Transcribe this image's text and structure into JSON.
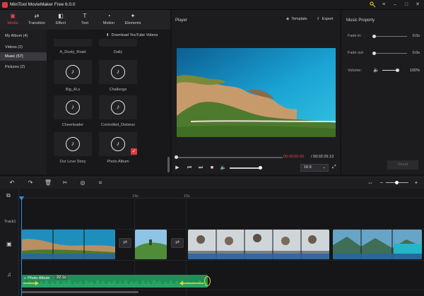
{
  "window": {
    "title": "MiniTool MovieMaker Free 6.0.0"
  },
  "top_tabs": [
    {
      "label": "Media",
      "icon": "media-icon",
      "active": true
    },
    {
      "label": "Transition",
      "icon": "transition-icon"
    },
    {
      "label": "Effect",
      "icon": "effect-icon"
    },
    {
      "label": "Text",
      "icon": "text-icon"
    },
    {
      "label": "Motion",
      "icon": "motion-icon"
    },
    {
      "label": "Elements",
      "icon": "elements-icon"
    }
  ],
  "library": {
    "nav": [
      "My Album (4)",
      "Videos (2)",
      "Music (57)",
      "Pictures (2)"
    ],
    "active_nav": "Music (57)",
    "download_label": "Download YouTube Videos",
    "items": [
      "A_Dusty_Road",
      "Daily",
      "Big_Al.s",
      "Challenge",
      "Cheerleader",
      "Controlled_Distress",
      "Our Love Story",
      "Photo Album"
    ]
  },
  "player": {
    "label": "Player",
    "template_label": "Template",
    "export_label": "Export",
    "time_current": "00:00:00.00",
    "time_total": "/ 00:02:29.13",
    "aspect_ratio": "16:9"
  },
  "property": {
    "title": "Music Property",
    "fade_in_label": "Fade in:",
    "fade_in_value": "0.0s",
    "fade_out_label": "Fade out:",
    "fade_out_value": "0.0s",
    "volume_label": "Volume:",
    "volume_value": "100%",
    "reset_label": "Reset"
  },
  "timeline": {
    "ticks": [
      "14s",
      "19s"
    ],
    "track_label": "Track1",
    "audio_clip_label": "Photo Album",
    "audio_clip_duration": "22.1s"
  },
  "colors": {
    "accent": "#e24646",
    "playhead": "#2a8ee0",
    "audio": "#1f8f58"
  }
}
